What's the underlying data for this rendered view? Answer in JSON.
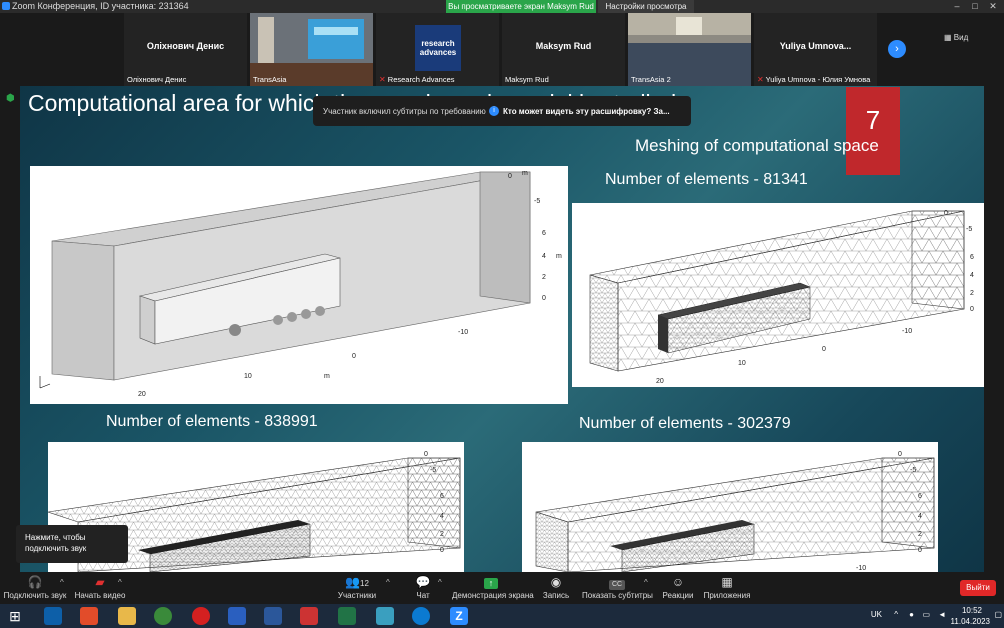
{
  "window": {
    "title": "Zoom Конференция, ID участника: 231364",
    "share_banner": "Вы просматриваете экран Maksym Rud",
    "view_settings": "Настройки просмотра",
    "view_label": "Вид"
  },
  "participants": [
    {
      "display": "Оліхнович Денис",
      "label": "Оліхнович Денис",
      "muted": false
    },
    {
      "display": "",
      "label": "TransAsia",
      "muted": false
    },
    {
      "display": "research advances",
      "label": "Research Advances",
      "muted": true
    },
    {
      "display": "Maksym Rud",
      "label": "Maksym Rud",
      "muted": false
    },
    {
      "display": "",
      "label": "TransAsia 2",
      "muted": false
    },
    {
      "display": "Yuliya Umnova...",
      "label": "Yuliya Umnova - Юлия Умнова",
      "muted": true
    }
  ],
  "slide": {
    "title": "Computational area for which the aerodynamic model is studied",
    "number": "7",
    "meshing_heading": "Meshing of computational space",
    "captions": [
      "Number of elements - 81341",
      "Number of elements - 838991",
      "Number of elements - 302379"
    ],
    "axis": {
      "x_ticks": [
        "20",
        "10",
        "0",
        "-10"
      ],
      "y_ticks": [
        "0",
        "2",
        "4",
        "6",
        "-5"
      ],
      "unit": "m",
      "small_x_ticks": [
        "20",
        "10",
        "0",
        "-10"
      ]
    }
  },
  "subtitles_bar": {
    "notice": "Участник включил субтитры по требованию",
    "question": "Кто может видеть эту расшифровку? За..."
  },
  "audio_hint": {
    "text": "Нажмите, чтобы подключить звук"
  },
  "toolbar": {
    "join_audio": "Подключить звук",
    "start_video": "Начать видео",
    "participants": "Участники",
    "participants_count": "12",
    "chat": "Чат",
    "share_screen": "Демонстрация экрана",
    "record": "Запись",
    "captions": "Показать субтитры",
    "reactions": "Реакции",
    "apps": "Приложения",
    "leave": "Выйти"
  },
  "taskbar": {
    "lang": "UK",
    "time": "10:52",
    "date": "11.04.2023"
  },
  "colors": {
    "share_green": "#2aa54a",
    "slide_number_red": "#c0282c",
    "leave_red": "#e02828",
    "zoom_blue": "#2d8cff"
  }
}
